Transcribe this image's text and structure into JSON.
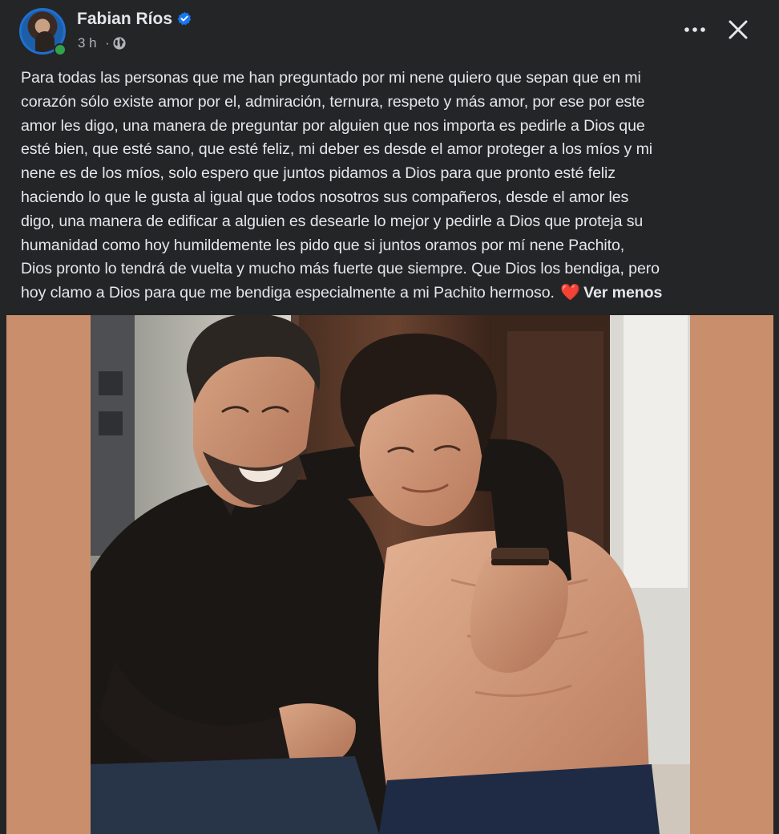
{
  "post": {
    "author": "Fabian Ríos",
    "time": "3 h",
    "separator": "·",
    "text_lines": [
      "Para todas las personas que me han preguntado por mi nene quiero que sepan que en mi",
      "corazón sólo existe amor por el, admiración, ternura, respeto y más amor, por ese por este",
      "amor les digo, una manera de preguntar por alguien que nos importa es pedirle a Dios que",
      "esté bien, que esté sano, que esté feliz, mi deber es desde el amor proteger a los míos y mi",
      "nene es de los míos, solo espero que juntos pidamos a Dios para que pronto esté feliz",
      "haciendo lo que le gusta al igual que todos nosotros sus compañeros, desde el amor les",
      "digo, una manera de edificar a alguien es desearle lo mejor y pedirle a Dios que proteja su",
      "humanidad como hoy humildemente les pido que si juntos oramos por mí nene Pachito,",
      "Dios pronto lo tendrá de vuelta y mucho más fuerte que siempre. Que Dios los bendiga, pero",
      "hoy clamo a Dios para que me bendiga especialmente a mi Pachito hermoso."
    ],
    "heart": "❤️",
    "see_less": "Ver menos"
  },
  "icons": {
    "verified": "verified-badge-icon",
    "audience": "globe-icon",
    "more": "more-options-icon",
    "close": "close-icon"
  },
  "colors": {
    "background": "#242526",
    "text": "#e4e6eb",
    "secondary_text": "#b0b3b8",
    "verified_blue": "#1877f2",
    "photo_border": "#c98f6c",
    "heart": "#e41e3f"
  }
}
